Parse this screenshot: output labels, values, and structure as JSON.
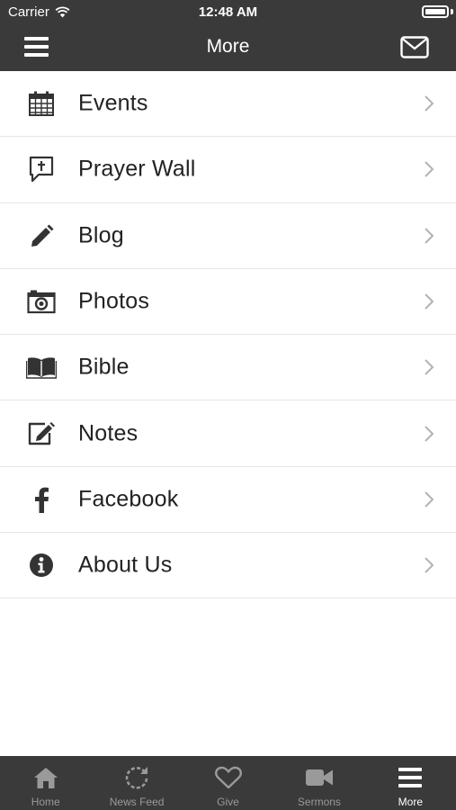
{
  "status_bar": {
    "carrier": "Carrier",
    "time": "12:48 AM",
    "battery_level": 1.0
  },
  "nav": {
    "title": "More",
    "menu_icon": "hamburger-icon",
    "mail_icon": "envelope-icon"
  },
  "menu": {
    "items": [
      {
        "label": "Events",
        "icon": "calendar-icon"
      },
      {
        "label": "Prayer Wall",
        "icon": "prayer-bubble-icon"
      },
      {
        "label": "Blog",
        "icon": "pencil-icon"
      },
      {
        "label": "Photos",
        "icon": "camera-icon"
      },
      {
        "label": "Bible",
        "icon": "open-book-icon"
      },
      {
        "label": "Notes",
        "icon": "edit-note-icon"
      },
      {
        "label": "Facebook",
        "icon": "facebook-icon"
      },
      {
        "label": "About Us",
        "icon": "info-icon"
      }
    ]
  },
  "tabs": {
    "items": [
      {
        "label": "Home",
        "icon": "home-icon"
      },
      {
        "label": "News Feed",
        "icon": "refresh-icon"
      },
      {
        "label": "Give",
        "icon": "heart-icon"
      },
      {
        "label": "Sermons",
        "icon": "video-camera-icon"
      },
      {
        "label": "More",
        "icon": "hamburger-icon",
        "active": true
      }
    ]
  },
  "colors": {
    "bar": "#3a3a3a",
    "text": "#222222",
    "tab_inactive": "#9a9a9a",
    "tab_active": "#ffffff",
    "divider": "#e6e6e6"
  }
}
